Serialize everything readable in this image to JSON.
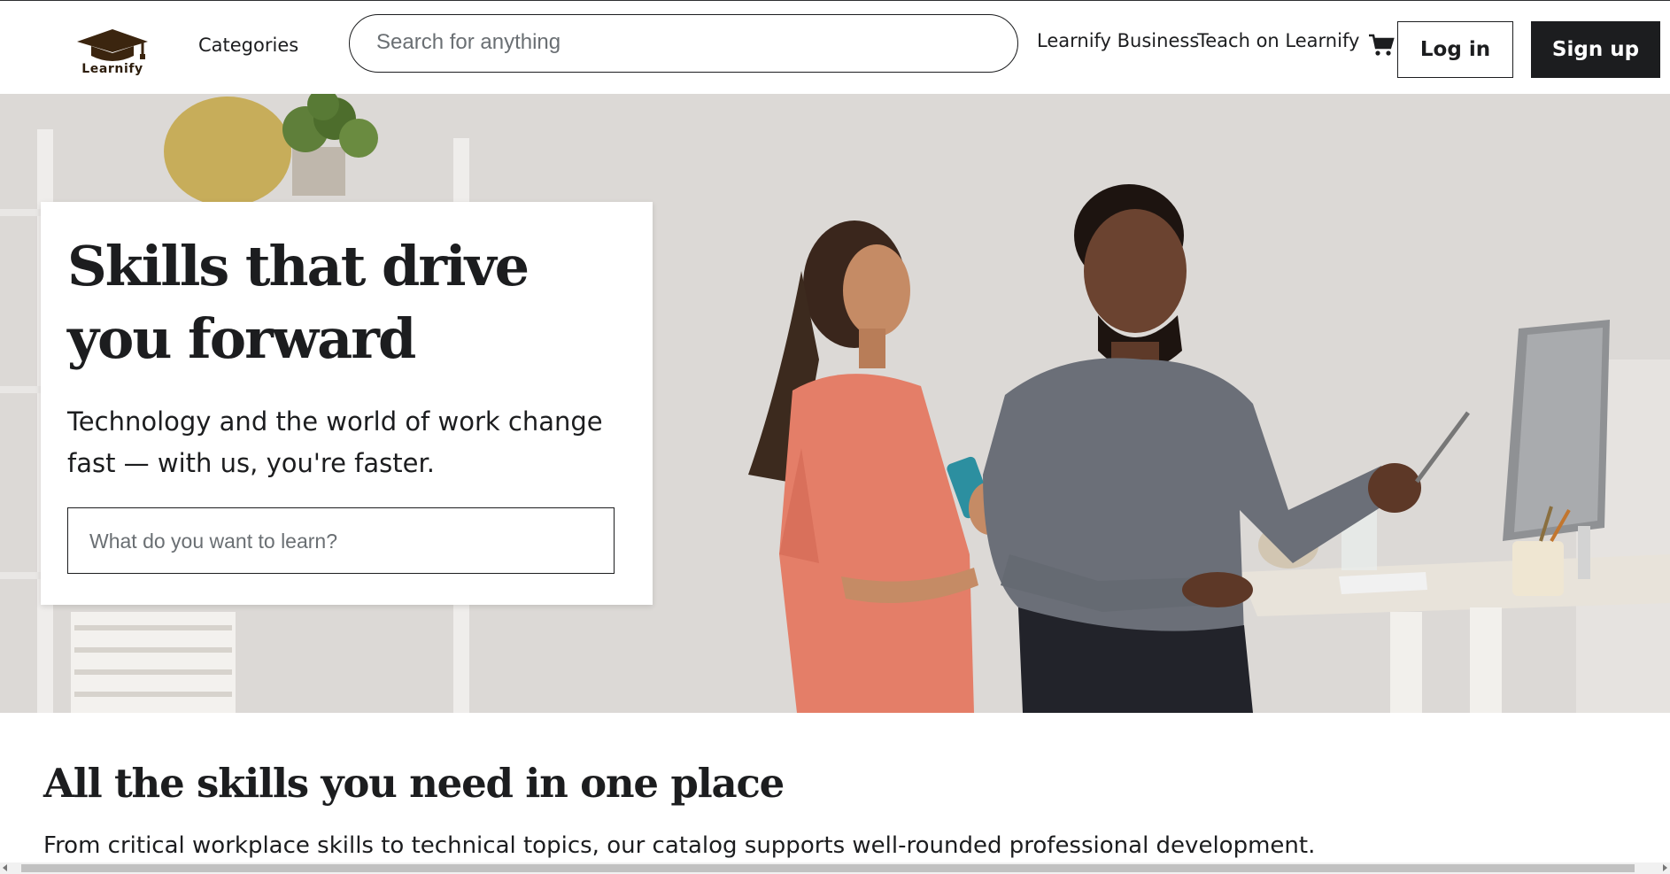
{
  "header": {
    "logo_text": "Learnify",
    "categories_label": "Categories",
    "search_placeholder": "Search for anything",
    "business_link": "Learnify Business",
    "teach_link": "Teach on Learnify",
    "login_label": "Log in",
    "signup_label": "Sign up",
    "icons": [
      "graduation-cap-icon",
      "cart-icon"
    ]
  },
  "hero": {
    "title_line1": "Skills that drive",
    "title_line2": "you forward",
    "subtitle_line1": "Technology and the world of work change",
    "subtitle_line2": "fast — with us, you're faster.",
    "search_placeholder": "What do you want to learn?"
  },
  "skills": {
    "title": "All the skills you need in one place",
    "subtitle": "From critical workplace skills to technical topics, our catalog supports well-rounded professional development."
  },
  "colors": {
    "text": "#1c1d1f",
    "button_dark": "#1c1d1f",
    "placeholder": "#6a6f73",
    "logo_brown": "#3b250f",
    "hero_bg": "#dcd9d6"
  }
}
